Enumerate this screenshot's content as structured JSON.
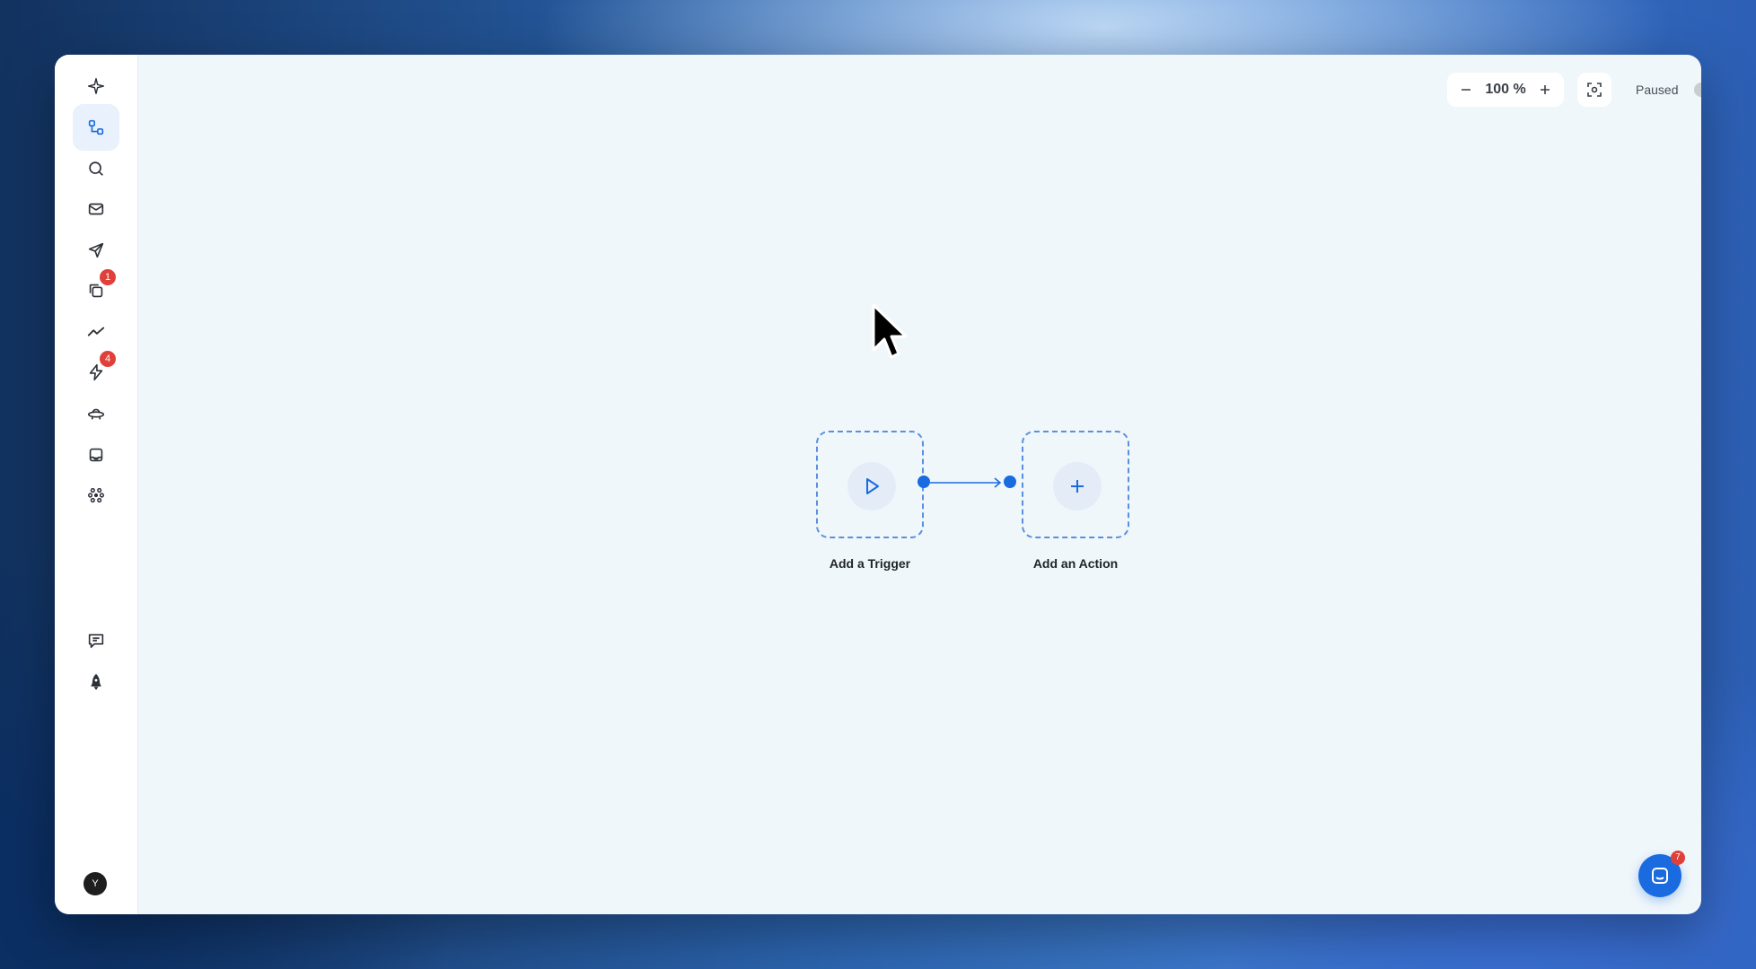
{
  "sidebar": {
    "items": [
      {
        "name": "sparkle-icon",
        "badge": ""
      },
      {
        "name": "workflow-icon",
        "badge": "",
        "active": true
      },
      {
        "name": "search-icon",
        "badge": ""
      },
      {
        "name": "mail-icon",
        "badge": ""
      },
      {
        "name": "send-icon",
        "badge": ""
      },
      {
        "name": "copy-icon",
        "badge": "1"
      },
      {
        "name": "trend-icon",
        "badge": ""
      },
      {
        "name": "lightning-icon",
        "badge": "4"
      },
      {
        "name": "ufo-icon",
        "badge": ""
      },
      {
        "name": "inbox-icon",
        "badge": ""
      },
      {
        "name": "integrations-icon",
        "badge": ""
      },
      {
        "name": "feedback-icon",
        "badge": ""
      },
      {
        "name": "rocket-icon",
        "badge": ""
      }
    ],
    "avatar_initial": "Y"
  },
  "toolbar": {
    "zoom_level": "100 %",
    "status_label": "Paused",
    "status_active": false
  },
  "flow": {
    "trigger_label": "Add a Trigger",
    "action_label": "Add an Action"
  },
  "chat": {
    "badge": "7"
  },
  "colors": {
    "accent": "#1a6be0",
    "badge": "#e0403a",
    "canvas_bg": "#f0f7fb"
  }
}
